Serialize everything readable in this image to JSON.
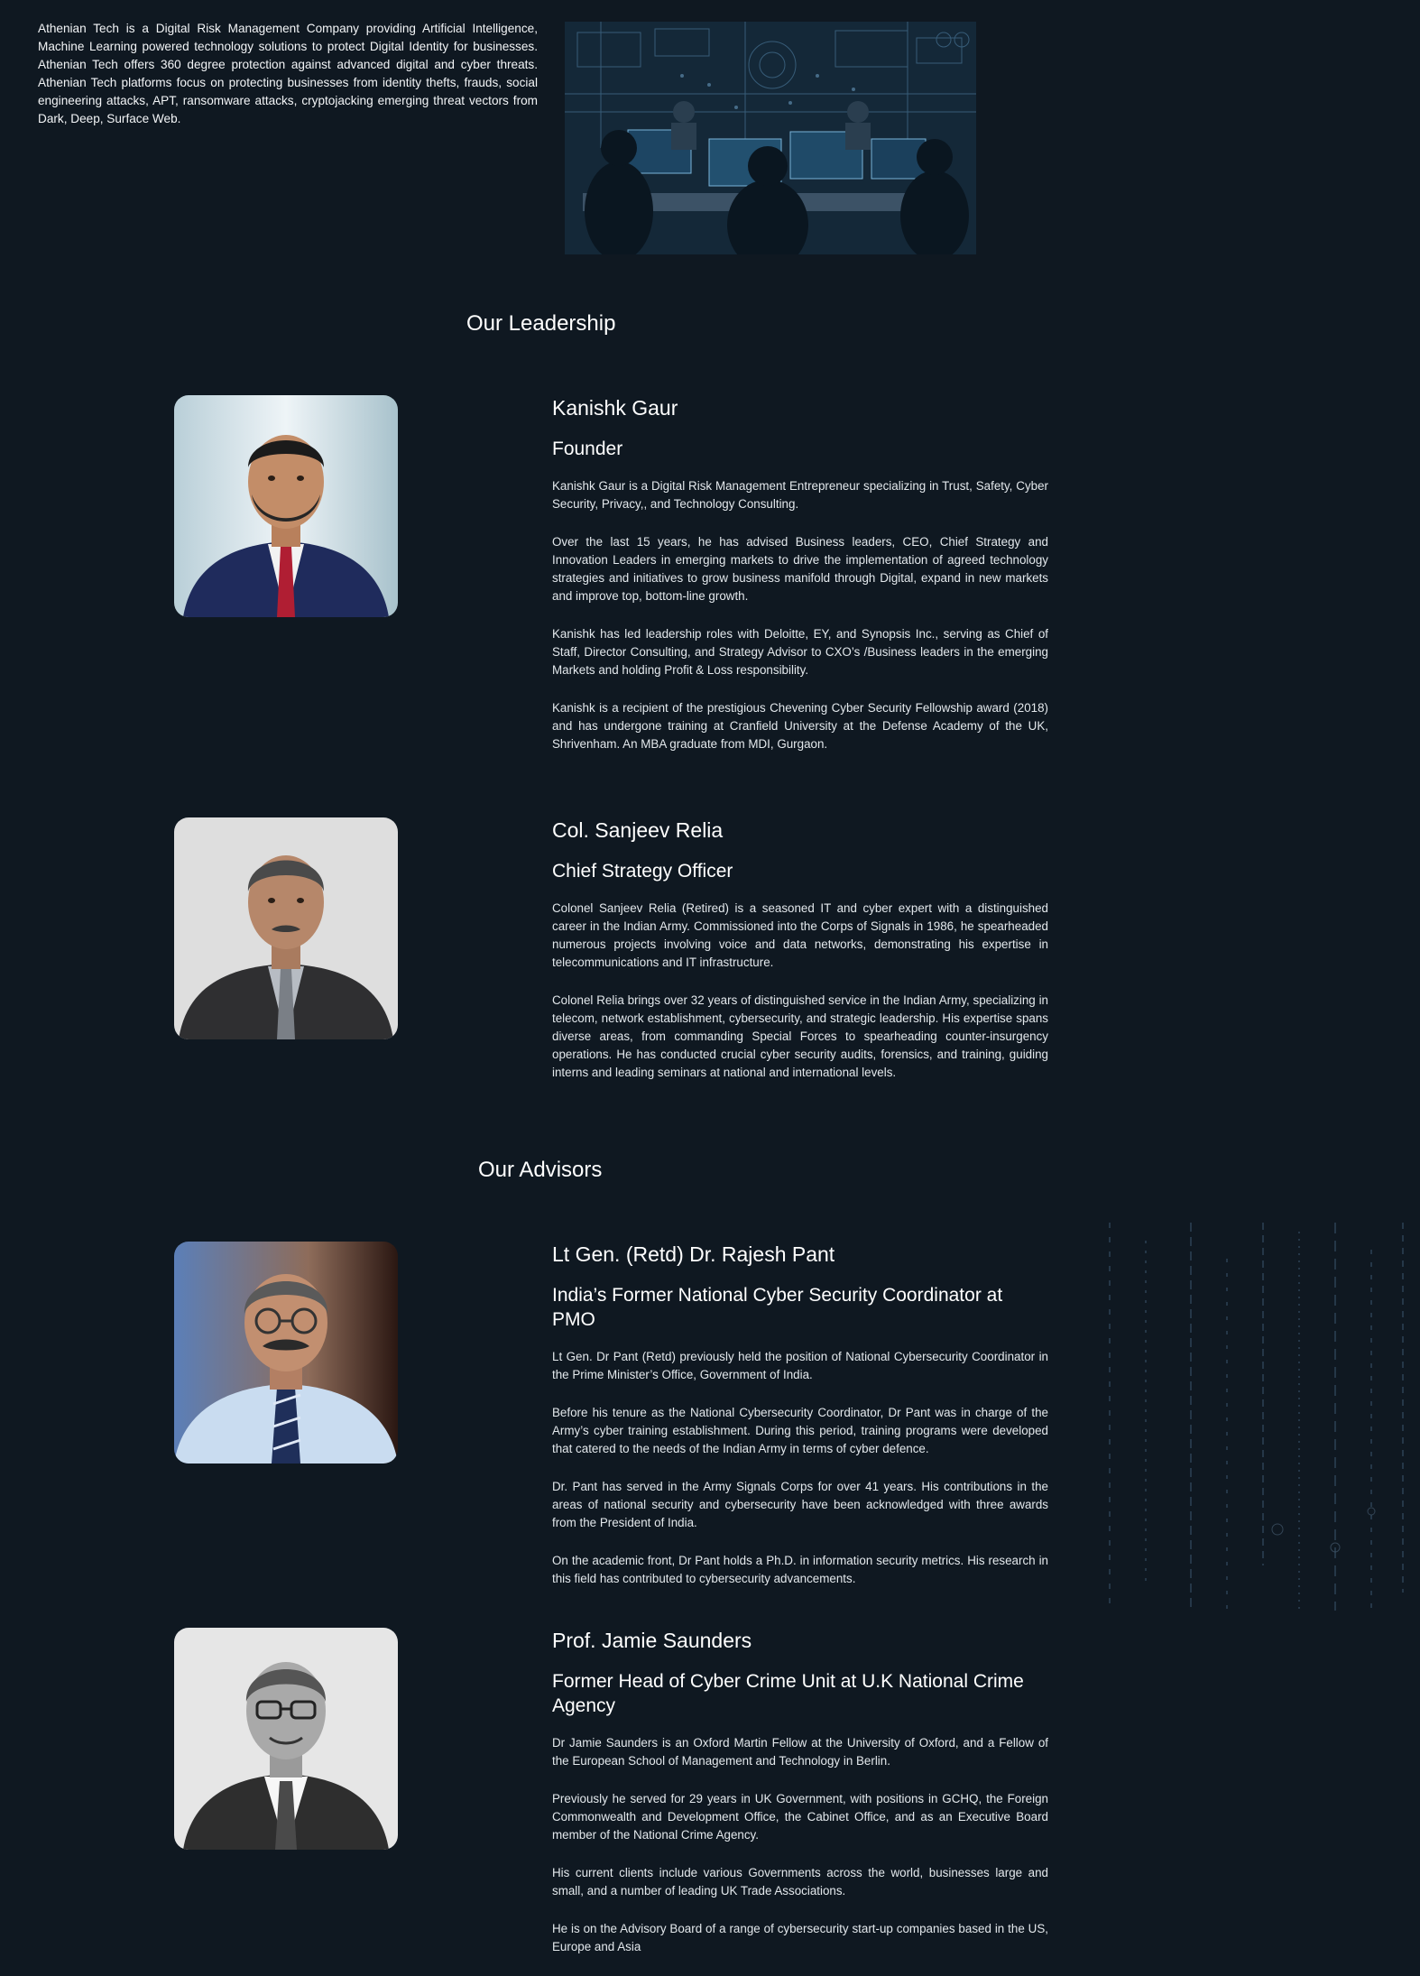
{
  "intro": {
    "text": "Athenian Tech is a Digital Risk Management Company providing Artificial Intelligence, Machine Learning powered technology solutions to protect Digital Identity for businesses. Athenian Tech offers 360 degree protection against advanced digital and cyber threats. Athenian Tech platforms focus on protecting businesses from identity thefts, frauds, social engineering attacks, APT, ransomware attacks, cryptojacking emerging threat vectors from Dark, Deep, Surface Web."
  },
  "leadership": {
    "heading": "Our Leadership",
    "people": [
      {
        "name": "Kanishk Gaur",
        "role": "Founder",
        "paragraphs": [
          "Kanishk Gaur is a Digital Risk Management Entrepreneur specializing in Trust, Safety, Cyber Security, Privacy,, and Technology Consulting.",
          "Over the last 15 years, he has advised Business leaders, CEO, Chief Strategy and Innovation Leaders in emerging markets to drive the implementation of agreed technology strategies and initiatives to grow business manifold through Digital, expand in new markets and improve top, bottom-line growth.",
          "Kanishk has led leadership roles with Deloitte, EY, and Synopsis Inc., serving as Chief of Staff, Director Consulting, and Strategy Advisor to CXO’s /Business leaders in the emerging Markets and holding Profit & Loss responsibility.",
          "Kanishk is a recipient of the prestigious Chevening Cyber Security Fellowship award (2018) and has undergone training at Cranfield University at the Defense Academy of the UK, Shrivenham. An MBA graduate from MDI, Gurgaon."
        ]
      },
      {
        "name": "Col. Sanjeev Relia",
        "role": "Chief Strategy Officer",
        "paragraphs": [
          "Colonel Sanjeev Relia (Retired) is a seasoned IT and cyber expert with a distinguished career in the Indian Army. Commissioned into the Corps of Signals in 1986, he spearheaded numerous projects involving voice and data networks, demonstrating his expertise in telecommunications and IT infrastructure.",
          "Colonel Relia brings over 32 years of distinguished service in the Indian Army, specializing in telecom, network establishment, cybersecurity, and strategic leadership. His expertise spans diverse areas, from commanding Special Forces to spearheading counter-insurgency operations. He has conducted crucial cyber security audits, forensics, and training, guiding interns and leading seminars at national and international levels."
        ]
      }
    ]
  },
  "advisors": {
    "heading": "Our Advisors",
    "people": [
      {
        "name": "Lt Gen. (Retd) Dr. Rajesh Pant",
        "role": "India’s Former National Cyber Security Coordinator at PMO",
        "paragraphs": [
          "Lt Gen. Dr Pant (Retd) previously held the position of National Cybersecurity Coordinator in the Prime Minister’s Office, Government of India.",
          "Before his tenure as the National Cybersecurity Coordinator, Dr Pant was in charge of the Army’s cyber training establishment. During this period, training programs were developed that catered to the needs of the Indian Army in terms of cyber defence.",
          "Dr. Pant has served in the Army Signals Corps for over 41 years. His contributions in the areas of national security and cybersecurity have been acknowledged with three awards from the President of India.",
          "On the academic front, Dr Pant holds a Ph.D. in information security metrics. His research in this field has contributed to cybersecurity advancements."
        ]
      },
      {
        "name": "Prof. Jamie Saunders",
        "role": "Former Head of Cyber Crime Unit at U.K National Crime Agency",
        "paragraphs": [
          "Dr Jamie Saunders is an Oxford Martin Fellow at the University of Oxford, and a Fellow of the European School of Management and Technology in Berlin.",
          "Previously he served for 29 years in UK Government, with positions in GCHQ, the Foreign Commonwealth and Development Office, the Cabinet Office, and as an Executive Board member of the National Crime Agency.",
          "His current clients include various Governments across the world, businesses large and small, and a number of leading UK Trade Associations.",
          "He is on the Advisory Board of a range of cybersecurity start-up companies based in the US, Europe and Asia"
        ]
      }
    ]
  },
  "colors": {
    "background": "#0f1821",
    "text": "#e9edf1",
    "heading": "#ffffff"
  }
}
